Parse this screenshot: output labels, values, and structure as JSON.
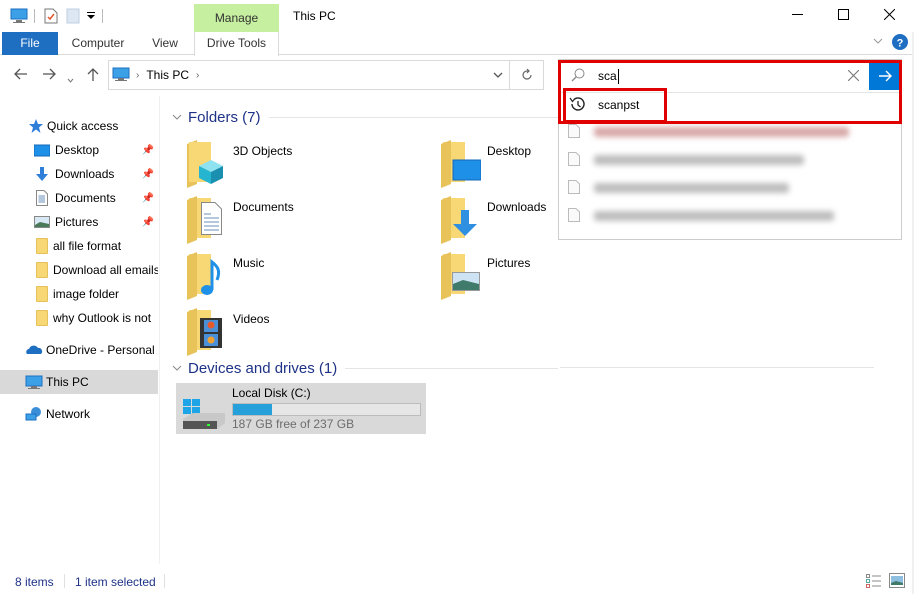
{
  "window": {
    "title": "This PC",
    "contextual_tab_group": "Manage",
    "controls": [
      "minimize",
      "maximize",
      "close"
    ]
  },
  "ribbon": {
    "tabs": [
      {
        "label": "File",
        "active": true
      },
      {
        "label": "Computer"
      },
      {
        "label": "View"
      },
      {
        "label": "Drive Tools"
      }
    ]
  },
  "address": {
    "path": [
      "This PC"
    ],
    "location_icon": "this-pc-icon"
  },
  "search": {
    "query": "sca",
    "suggestions": [
      {
        "label": "scanpst",
        "type": "history",
        "highlighted": true
      }
    ],
    "blurred_results_count": 4
  },
  "nav": {
    "quick_access": "Quick access",
    "items": [
      {
        "label": "Desktop",
        "icon": "desktop-icon",
        "pinned": true
      },
      {
        "label": "Downloads",
        "icon": "downloads-icon",
        "pinned": true
      },
      {
        "label": "Documents",
        "icon": "documents-icon",
        "pinned": true
      },
      {
        "label": "Pictures",
        "icon": "pictures-icon",
        "pinned": true
      },
      {
        "label": "all file format",
        "icon": "folder-icon",
        "pinned": false
      },
      {
        "label": "Download all emails",
        "icon": "folder-icon",
        "pinned": false
      },
      {
        "label": "image folder",
        "icon": "folder-icon",
        "pinned": false
      },
      {
        "label": "why Outlook is not",
        "icon": "folder-icon",
        "pinned": false
      }
    ],
    "onedrive": "OneDrive - Personal",
    "this_pc": "This PC",
    "network": "Network"
  },
  "content": {
    "folders_header": "Folders (7)",
    "folders": [
      {
        "label": "3D Objects",
        "icon": "3d-objects-icon"
      },
      {
        "label": "Desktop",
        "icon": "desktop-icon"
      },
      {
        "label": "Documents",
        "icon": "documents-icon"
      },
      {
        "label": "Downloads",
        "icon": "downloads-icon"
      },
      {
        "label": "Music",
        "icon": "music-icon"
      },
      {
        "label": "Pictures",
        "icon": "pictures-icon"
      },
      {
        "label": "Videos",
        "icon": "videos-icon"
      }
    ],
    "devices_header": "Devices and drives (1)",
    "drives": [
      {
        "label": "Local Disk (C:)",
        "free_text": "187 GB free of 237 GB",
        "used_fraction": 0.21
      }
    ]
  },
  "status": {
    "items_count": "8 items",
    "selection": "1 item selected"
  },
  "colors": {
    "accent": "#0078d7",
    "file_tab": "#1e6fc1",
    "manage_tab": "#c6efa0",
    "highlight_box": "#e00000",
    "header_text": "#1e3287",
    "drive_bar": "#26a0da",
    "selection_bg": "#d9d9d9"
  }
}
